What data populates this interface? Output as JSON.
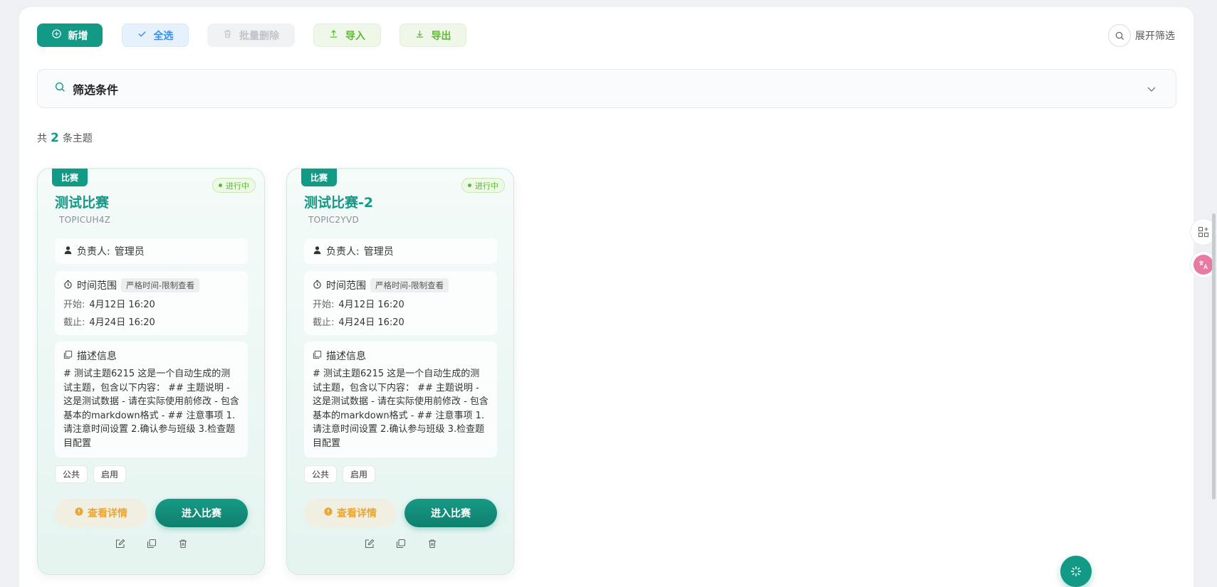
{
  "toolbar": {
    "add_label": "新增",
    "select_all_label": "全选",
    "batch_delete_label": "批量删除",
    "import_label": "导入",
    "export_label": "导出",
    "expand_filter_label": "展开筛选"
  },
  "filter": {
    "title": "筛选条件"
  },
  "summary": {
    "prefix": "共",
    "count": "2",
    "suffix": "条主题"
  },
  "colors": {
    "accent": "#139a86",
    "status_green": "#5fb43a",
    "view_orange": "#e7a63a"
  },
  "cards": [
    {
      "type_tag": "比赛",
      "status": "进行中",
      "title": "测试比赛",
      "code": "TOPICUH4Z",
      "owner_label": "负责人:",
      "owner": "管理员",
      "time_label": "时间范围",
      "time_badge": "严格时间-限制查看",
      "start_label": "开始:",
      "start": "4月12日 16:20",
      "end_label": "截止:",
      "end": "4月24日 16:20",
      "desc_label": "描述信息",
      "desc": "# 测试主题6215 这是一个自动生成的测试主题，包含以下内容： ## 主题说明 - 这是测试数据 - 请在实际使用前修改 - 包含基本的markdown格式 - ## 注意事项 1. 请注意时间设置 2.确认参与班级 3.检查题目配置",
      "tags": [
        "公共",
        "启用"
      ],
      "view_label": "查看详情",
      "enter_label": "进入比赛"
    },
    {
      "type_tag": "比赛",
      "status": "进行中",
      "title": "测试比赛-2",
      "code": "TOPIC2YVD",
      "owner_label": "负责人:",
      "owner": "管理员",
      "time_label": "时间范围",
      "time_badge": "严格时间-限制查看",
      "start_label": "开始:",
      "start": "4月12日 16:20",
      "end_label": "截止:",
      "end": "4月24日 16:20",
      "desc_label": "描述信息",
      "desc": "# 测试主题6215 这是一个自动生成的测试主题，包含以下内容： ## 主题说明 - 这是测试数据 - 请在实际使用前修改 - 包含基本的markdown格式 - ## 注意事项 1. 请注意时间设置 2.确认参与班级 3.检查题目配置",
      "tags": [
        "公共",
        "启用"
      ],
      "view_label": "查看详情",
      "enter_label": "进入比赛"
    }
  ],
  "icons": {
    "add": "plus-circle-icon",
    "select_all": "check-icon",
    "batch_delete": "trash-icon",
    "import": "upload-icon",
    "export": "download-icon",
    "expand_filter": "search-icon",
    "filter": "search-icon",
    "collapse": "chevron-down-icon",
    "owner": "user-icon",
    "time": "timer-icon",
    "desc": "document-icon",
    "view": "info-icon",
    "edit": "edit-icon",
    "copy": "copy-icon",
    "delete": "trash-icon",
    "side_apps": "apps-icon",
    "side_translate": "translate-icon",
    "fab": "sparkle-icon"
  }
}
